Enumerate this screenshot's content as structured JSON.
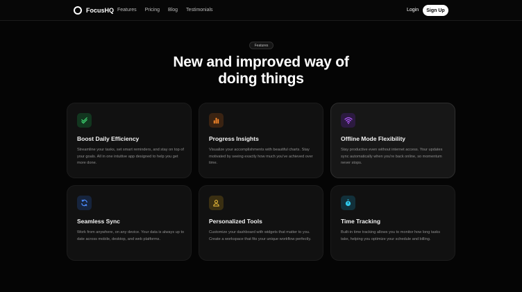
{
  "nav": {
    "brand": "FocusHQ",
    "links": [
      "Features",
      "Pricing",
      "Blog",
      "Testimonials"
    ],
    "login": "Login",
    "signup": "Sign Up"
  },
  "hero": {
    "badge": "Features",
    "headline": "New and improved way of doing things"
  },
  "features": [
    {
      "title": "Boost Daily Efficiency",
      "desc": "Streamline your tasks, set smart reminders, and stay on top of your goals. All in one intuitive app designed to help you get more done.",
      "icon": "check-double-icon",
      "accent": "#3ccf6e",
      "bg": "#12361f"
    },
    {
      "title": "Progress Insights",
      "desc": "Visualize your accomplishments with beautiful charts. Stay motivated by seeing exactly how much you've achieved over time.",
      "icon": "bar-chart-icon",
      "accent": "#ff8a2a",
      "bg": "#3a2312"
    },
    {
      "title": "Offline Mode Flexibility",
      "desc": "Stay productive even without internet access. Your updates sync automatically when you're back online, so momentum never stops.",
      "icon": "wifi-icon",
      "accent": "#b45cff",
      "bg": "#2c1a40"
    },
    {
      "title": "Seamless Sync",
      "desc": "Work from anywhere, on any device. Your data is always up to date across mobile, desktop, and web platforms.",
      "icon": "refresh-icon",
      "accent": "#4d8dff",
      "bg": "#16243d"
    },
    {
      "title": "Personalized Tools",
      "desc": "Customize your dashboard with widgets that matter to you. Create a workspace that fits your unique workflow perfectly.",
      "icon": "user-icon",
      "accent": "#e8b93a",
      "bg": "#3a2f12"
    },
    {
      "title": "Time Tracking",
      "desc": "Built-in time tracking allows you to monitor how long tasks take, helping you optimize your schedule and billing.",
      "icon": "stopwatch-icon",
      "accent": "#2fc6e8",
      "bg": "#12303a"
    }
  ]
}
